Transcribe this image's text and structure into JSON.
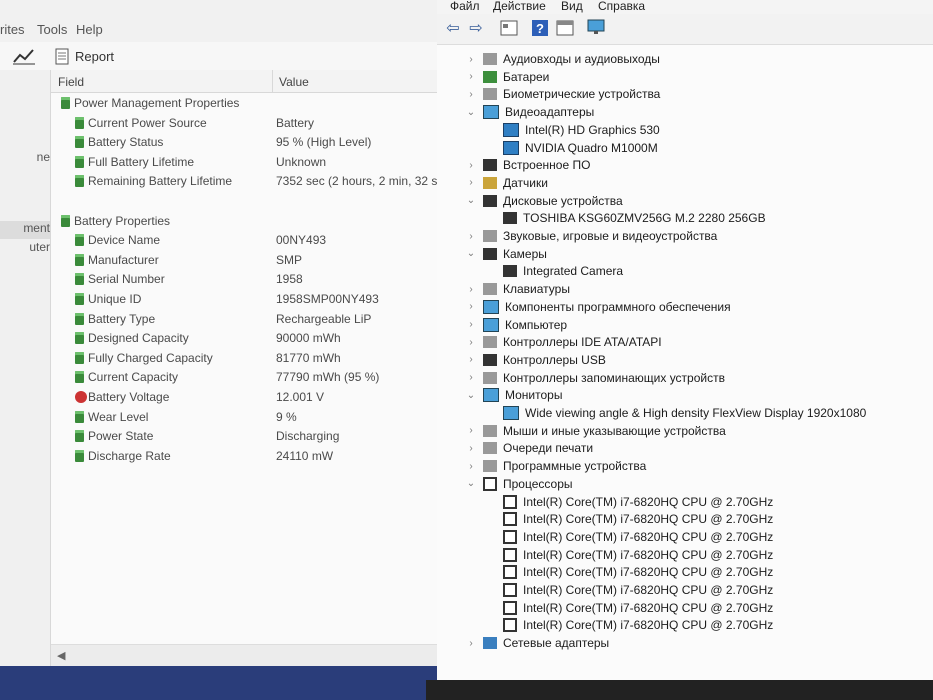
{
  "left_window": {
    "menu": [
      "rites",
      "Tools",
      "Help"
    ],
    "toolbar": {
      "report_label": "Report"
    },
    "sidebar": [
      "ne",
      "ment",
      "uter"
    ],
    "columns": {
      "field": "Field",
      "value": "Value"
    },
    "rows": [
      {
        "type": "group",
        "field": "Power Management Properties"
      },
      {
        "type": "item",
        "field": "Current Power Source",
        "value": "Battery"
      },
      {
        "type": "item",
        "field": "Battery Status",
        "value": "95 % (High Level)"
      },
      {
        "type": "item",
        "field": "Full Battery Lifetime",
        "value": "Unknown"
      },
      {
        "type": "item",
        "field": "Remaining Battery Lifetime",
        "value": "7352 sec (2 hours, 2 min, 32 s"
      },
      {
        "type": "blank"
      },
      {
        "type": "group",
        "field": "Battery Properties"
      },
      {
        "type": "item",
        "field": "Device Name",
        "value": "00NY493"
      },
      {
        "type": "item",
        "field": "Manufacturer",
        "value": "SMP"
      },
      {
        "type": "item",
        "field": "Serial Number",
        "value": "1958"
      },
      {
        "type": "item",
        "field": "Unique ID",
        "value": "1958SMP00NY493"
      },
      {
        "type": "item",
        "field": "Battery Type",
        "value": "Rechargeable LiP"
      },
      {
        "type": "item",
        "field": "Designed Capacity",
        "value": "90000 mWh"
      },
      {
        "type": "item",
        "field": "Fully Charged Capacity",
        "value": "81770 mWh"
      },
      {
        "type": "item",
        "field": "Current Capacity",
        "value": "77790 mWh  (95 %)"
      },
      {
        "type": "item",
        "field": "Battery Voltage",
        "value": "12.001 V",
        "icon": "bolt"
      },
      {
        "type": "item",
        "field": "Wear Level",
        "value": "9 %"
      },
      {
        "type": "item",
        "field": "Power State",
        "value": "Discharging"
      },
      {
        "type": "item",
        "field": "Discharge Rate",
        "value": "24110 mW"
      }
    ]
  },
  "right_window": {
    "menu": [
      "Файл",
      "Действие",
      "Вид",
      "Справка"
    ],
    "tree": [
      {
        "level": 0,
        "exp": "›",
        "icon": "gray",
        "label": "Аудиовходы и аудиовыходы"
      },
      {
        "level": 0,
        "exp": "›",
        "icon": "green",
        "label": "Батареи"
      },
      {
        "level": 0,
        "exp": "›",
        "icon": "gray",
        "label": "Биометрические устройства"
      },
      {
        "level": 0,
        "exp": "⌄",
        "icon": "mon",
        "label": "Видеоадаптеры"
      },
      {
        "level": 1,
        "exp": "",
        "icon": "gpu",
        "label": "Intel(R) HD Graphics 530"
      },
      {
        "level": 1,
        "exp": "",
        "icon": "gpu",
        "label": "NVIDIA Quadro M1000M"
      },
      {
        "level": 0,
        "exp": "›",
        "icon": "dark",
        "label": "Встроенное ПО"
      },
      {
        "level": 0,
        "exp": "›",
        "icon": "yellow",
        "label": "Датчики"
      },
      {
        "level": 0,
        "exp": "⌄",
        "icon": "dark",
        "label": "Дисковые устройства"
      },
      {
        "level": 1,
        "exp": "",
        "icon": "dark",
        "label": "TOSHIBA KSG60ZMV256G M.2 2280 256GB"
      },
      {
        "level": 0,
        "exp": "›",
        "icon": "gray",
        "label": "Звуковые, игровые и видеоустройства"
      },
      {
        "level": 0,
        "exp": "⌄",
        "icon": "dark",
        "label": "Камеры"
      },
      {
        "level": 1,
        "exp": "",
        "icon": "dark",
        "label": "Integrated Camera"
      },
      {
        "level": 0,
        "exp": "›",
        "icon": "gray",
        "label": "Клавиатуры"
      },
      {
        "level": 0,
        "exp": "›",
        "icon": "mon",
        "label": "Компоненты программного обеспечения"
      },
      {
        "level": 0,
        "exp": "›",
        "icon": "mon",
        "label": "Компьютер"
      },
      {
        "level": 0,
        "exp": "›",
        "icon": "gray",
        "label": "Контроллеры IDE ATA/ATAPI"
      },
      {
        "level": 0,
        "exp": "›",
        "icon": "dark",
        "label": "Контроллеры USB"
      },
      {
        "level": 0,
        "exp": "›",
        "icon": "gray",
        "label": "Контроллеры запоминающих устройств"
      },
      {
        "level": 0,
        "exp": "⌄",
        "icon": "mon",
        "label": "Мониторы"
      },
      {
        "level": 1,
        "exp": "",
        "icon": "mon",
        "label": "Wide viewing angle & High density FlexView Display 1920x1080"
      },
      {
        "level": 0,
        "exp": "›",
        "icon": "gray",
        "label": "Мыши и иные указывающие устройства"
      },
      {
        "level": 0,
        "exp": "›",
        "icon": "gray",
        "label": "Очереди печати"
      },
      {
        "level": 0,
        "exp": "›",
        "icon": "gray",
        "label": "Программные устройства"
      },
      {
        "level": 0,
        "exp": "⌄",
        "icon": "cpu",
        "label": "Процессоры"
      },
      {
        "level": 1,
        "exp": "",
        "icon": "cpu",
        "label": "Intel(R) Core(TM) i7-6820HQ CPU @ 2.70GHz"
      },
      {
        "level": 1,
        "exp": "",
        "icon": "cpu",
        "label": "Intel(R) Core(TM) i7-6820HQ CPU @ 2.70GHz"
      },
      {
        "level": 1,
        "exp": "",
        "icon": "cpu",
        "label": "Intel(R) Core(TM) i7-6820HQ CPU @ 2.70GHz"
      },
      {
        "level": 1,
        "exp": "",
        "icon": "cpu",
        "label": "Intel(R) Core(TM) i7-6820HQ CPU @ 2.70GHz"
      },
      {
        "level": 1,
        "exp": "",
        "icon": "cpu",
        "label": "Intel(R) Core(TM) i7-6820HQ CPU @ 2.70GHz"
      },
      {
        "level": 1,
        "exp": "",
        "icon": "cpu",
        "label": "Intel(R) Core(TM) i7-6820HQ CPU @ 2.70GHz"
      },
      {
        "level": 1,
        "exp": "",
        "icon": "cpu",
        "label": "Intel(R) Core(TM) i7-6820HQ CPU @ 2.70GHz"
      },
      {
        "level": 1,
        "exp": "",
        "icon": "cpu",
        "label": "Intel(R) Core(TM) i7-6820HQ CPU @ 2.70GHz"
      },
      {
        "level": 0,
        "exp": "›",
        "icon": "net",
        "label": "Сетевые адаптеры"
      }
    ]
  }
}
